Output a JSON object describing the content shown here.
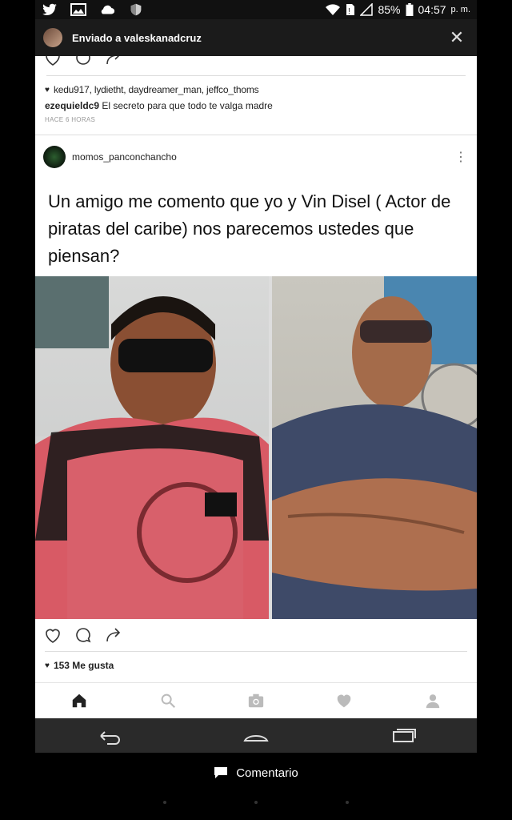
{
  "status_bar": {
    "battery": "85%",
    "time": "04:57",
    "ampm": "p. m."
  },
  "notification": {
    "text": "Enviado a valeskanadcruz"
  },
  "previous_post": {
    "likes_users": "kedu917, lydietht, daydreamer_man, jeffco_thoms",
    "comment_user": "ezequieldc9",
    "comment_text": "El secreto para que todo te valga madre",
    "time": "HACE 6 HORAS"
  },
  "post": {
    "username": "momos_panconchancho",
    "caption": "Un amigo me comento que yo y Vin Disel ( Actor de piratas del caribe) nos parecemos ustedes que piensan?",
    "likes": "153 Me gusta"
  },
  "footer": {
    "comment_label": "Comentario"
  },
  "icons": {
    "status": [
      "twitter-icon",
      "image-icon",
      "cloud-icon",
      "shield-icon",
      "wifi-icon",
      "sim-icon",
      "signal-icon",
      "battery-icon"
    ],
    "actions": [
      "heart-icon",
      "comment-icon",
      "share-icon"
    ],
    "bottom_nav": [
      "home-icon",
      "search-icon",
      "camera-icon",
      "activity-heart-icon",
      "profile-icon"
    ],
    "android_nav": [
      "back-icon",
      "home-icon",
      "recents-icon"
    ]
  }
}
